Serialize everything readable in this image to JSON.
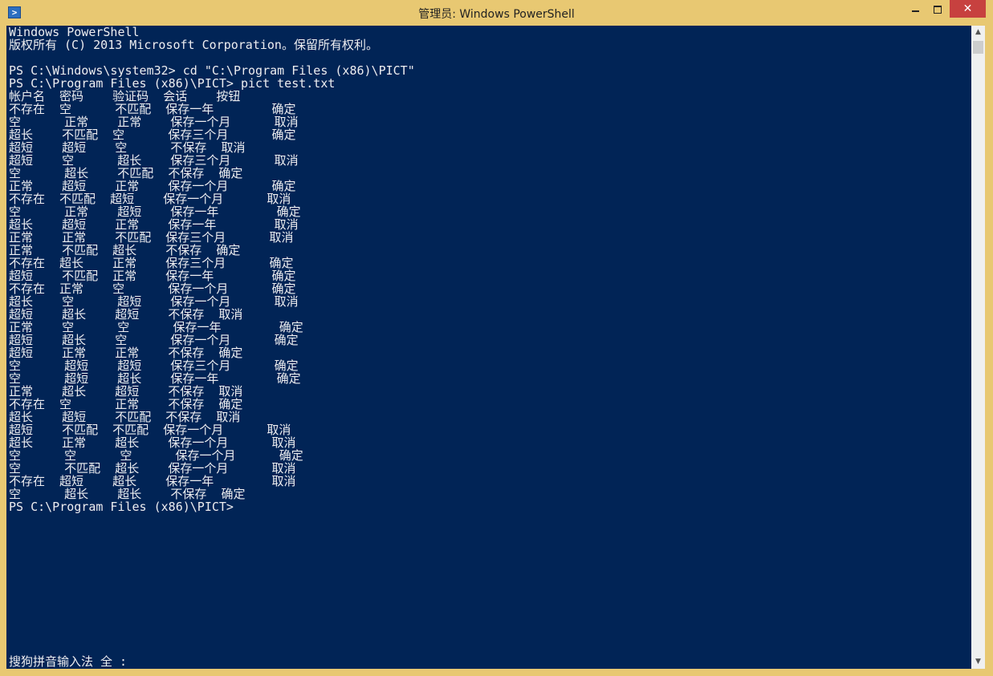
{
  "window": {
    "title": "管理员: Windows PowerShell",
    "icon": "powershell-icon",
    "controls": {
      "minimize": "minimize-icon",
      "maximize": "maximize-icon",
      "close": "✕"
    }
  },
  "colors": {
    "console_bg": "#012456",
    "console_fg": "#eeedf0",
    "frame": "#e8c872",
    "close_bg": "#c7413f"
  },
  "console": {
    "lines": [
      "Windows PowerShell",
      "版权所有 (C) 2013 Microsoft Corporation。保留所有权利。",
      "",
      "PS C:\\Windows\\system32> cd \"C:\\Program Files (x86)\\PICT\"",
      "PS C:\\Program Files (x86)\\PICT> pict test.txt",
      "帐户名  密码    验证码  会话    按钮",
      "不存在  空      不匹配  保存一年        确定",
      "空      正常    正常    保存一个月      取消",
      "超长    不匹配  空      保存三个月      确定",
      "超短    超短    空      不保存  取消",
      "超短    空      超长    保存三个月      取消",
      "空      超长    不匹配  不保存  确定",
      "正常    超短    正常    保存一个月      确定",
      "不存在  不匹配  超短    保存一个月      取消",
      "空      正常    超短    保存一年        确定",
      "超长    超短    正常    保存一年        取消",
      "正常    正常    不匹配  保存三个月      取消",
      "正常    不匹配  超长    不保存  确定",
      "不存在  超长    正常    保存三个月      确定",
      "超短    不匹配  正常    保存一年        确定",
      "不存在  正常    空      保存一个月      确定",
      "超长    空      超短    保存一个月      取消",
      "超短    超长    超短    不保存  取消",
      "正常    空      空      保存一年        确定",
      "超短    超长    空      保存一个月      确定",
      "超短    正常    正常    不保存  确定",
      "空      超短    超短    保存三个月      确定",
      "空      超短    超长    保存一年        确定",
      "正常    超长    超短    不保存  取消",
      "不存在  空      正常    不保存  确定",
      "超长    超短    不匹配  不保存  取消",
      "超短    不匹配  不匹配  保存一个月      取消",
      "超长    正常    超长    保存一个月      取消",
      "空      空      空      保存一个月      确定",
      "空      不匹配  超长    保存一个月      取消",
      "不存在  超短    超长    保存一年        取消",
      "空      超长    超长    不保存  确定",
      "PS C:\\Program Files (x86)\\PICT>"
    ],
    "ime_status": "搜狗拼音输入法 全 :"
  },
  "scrollbar": {
    "up": "▲",
    "down": "▼"
  }
}
